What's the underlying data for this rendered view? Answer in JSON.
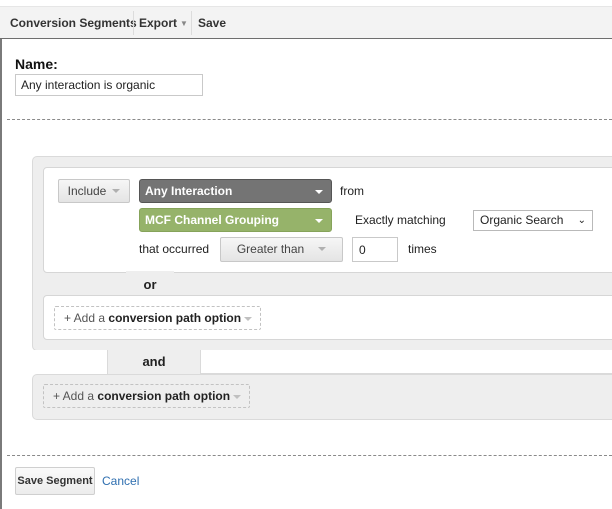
{
  "toolbar": {
    "conversion_segments": "Conversion Segments",
    "export": "Export",
    "save": "Save"
  },
  "name": {
    "label": "Name:",
    "value": "Any interaction is organic"
  },
  "condition": {
    "include": "Include",
    "interaction": "Any Interaction",
    "from": "from",
    "dimension": "MCF Channel Grouping",
    "match_type": "Exactly matching",
    "match_value": "Organic Search",
    "that_occurred": "that occurred",
    "comparison": "Greater than",
    "count": "0",
    "times": "times"
  },
  "logic": {
    "or": "or",
    "and": "and"
  },
  "add_option": {
    "prefix": "+ Add a",
    "bold": "conversion path option"
  },
  "footer": {
    "save_segment": "Save Segment",
    "cancel": "Cancel"
  },
  "colors": {
    "interaction_dropdown": "#747474",
    "dimension_dropdown": "#96b36a",
    "link": "#2f6fb0"
  }
}
